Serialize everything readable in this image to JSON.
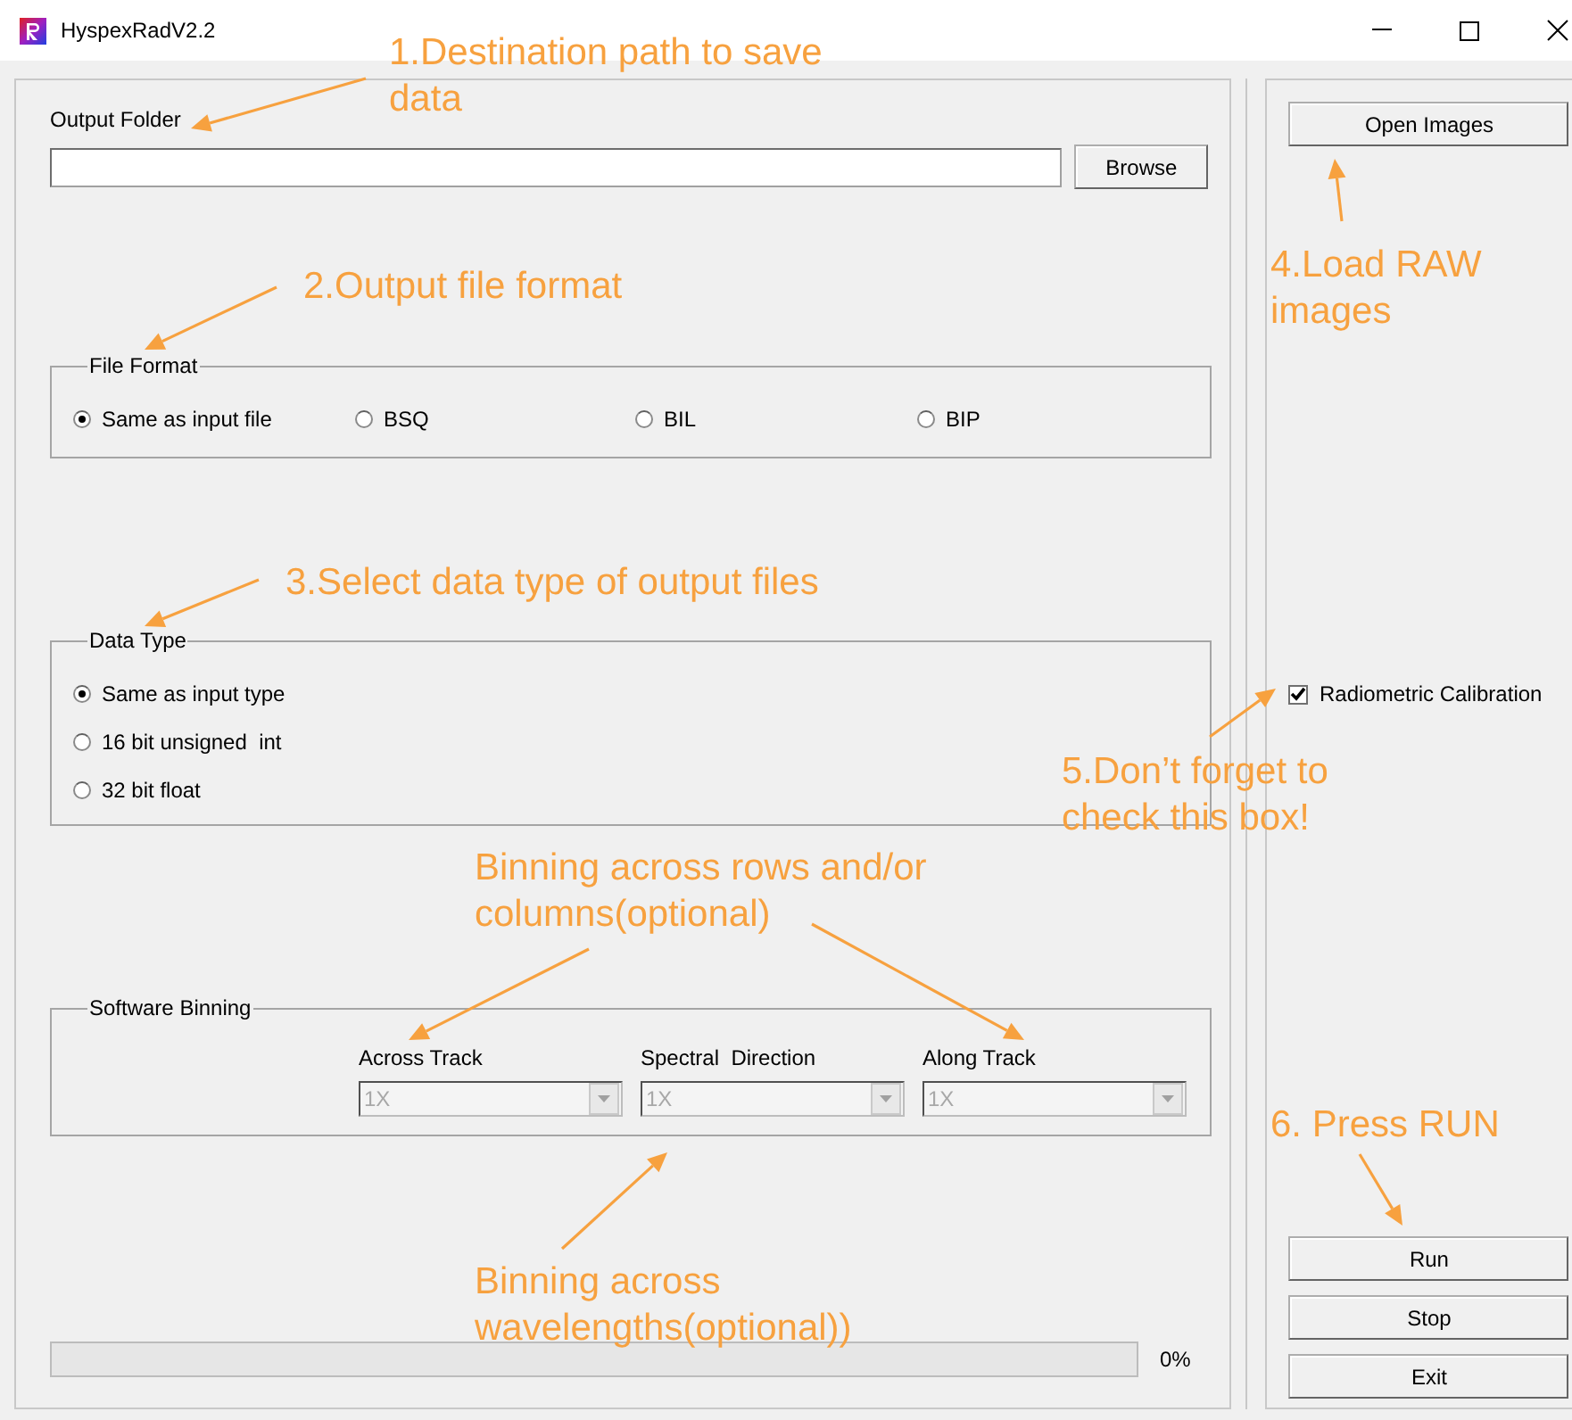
{
  "window": {
    "title": "HyspexRadV2.2"
  },
  "output_folder": {
    "label": "Output Folder",
    "browse_button": "Browse"
  },
  "file_format": {
    "title": "File Format",
    "options": [
      {
        "label": "Same as input file",
        "selected": true
      },
      {
        "label": "BSQ",
        "selected": false
      },
      {
        "label": "BIL",
        "selected": false
      },
      {
        "label": "BIP",
        "selected": false
      }
    ]
  },
  "data_type": {
    "title": "Data Type",
    "options": [
      {
        "label": "Same as input type",
        "selected": true
      },
      {
        "label": "16 bit unsigned  int",
        "selected": false
      },
      {
        "label": "32 bit float",
        "selected": false
      }
    ]
  },
  "software_binning": {
    "title": "Software Binning",
    "selectors": [
      {
        "label": "Across Track",
        "value": "1X",
        "disabled": true
      },
      {
        "label": "Spectral  Direction",
        "value": "1X",
        "disabled": true
      },
      {
        "label": "Along Track",
        "value": "1X",
        "disabled": true
      }
    ]
  },
  "progress": {
    "level": 0,
    "reading": "0%"
  },
  "side_panel": {
    "open_button": "Open Images",
    "radiometric_calibration": {
      "label": "Radiometric Calibration",
      "checked": true
    },
    "buttons": [
      "Run",
      "Stop",
      "Exit"
    ]
  },
  "annotations": [
    {
      "text": "1.Destination path to save data"
    },
    {
      "text": "2.Output file format"
    },
    {
      "text": "3.Select data type of output files"
    },
    {
      "text": "4.Load RAW images"
    },
    {
      "text": "5.Don’t forget to check this box!"
    },
    {
      "text": "Binning across rows and/or columns(optional)"
    },
    {
      "text": "Binning across wavelengths(optional))"
    },
    {
      "text": "6. Press RUN"
    }
  ]
}
